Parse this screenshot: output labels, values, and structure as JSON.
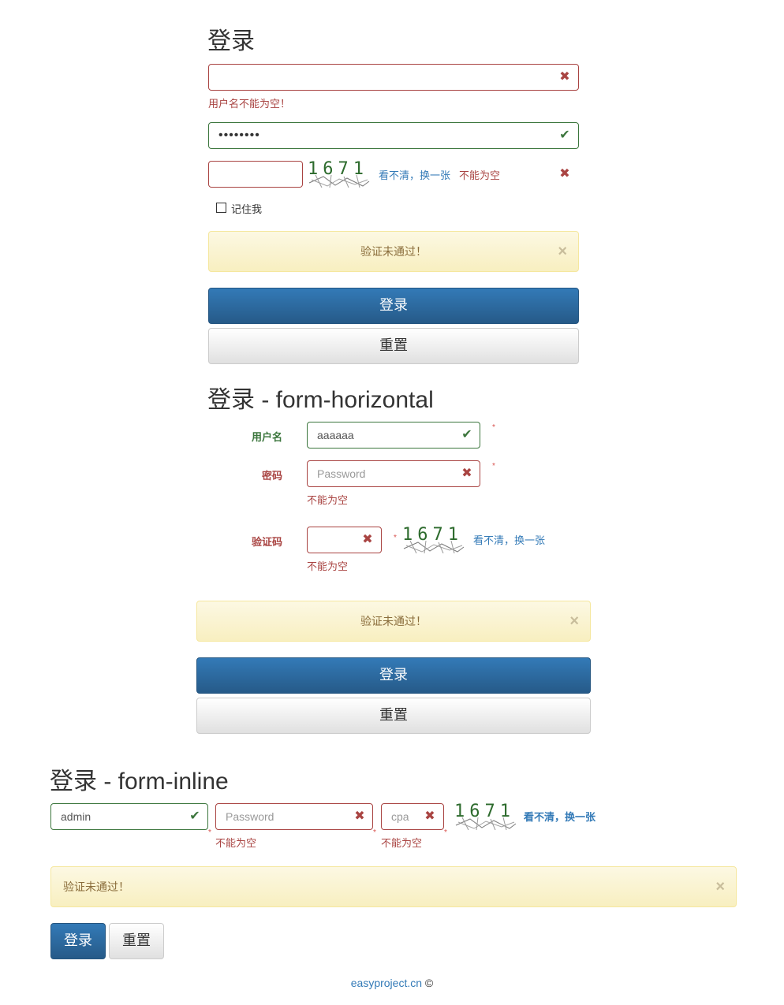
{
  "section1": {
    "title": "登录",
    "username_error": "用户名不能为空！",
    "password_value": "••••••••",
    "captcha_digits": "1671",
    "refresh_link": "看不清，换一张",
    "captcha_error": "不能为空",
    "remember_label": "记住我",
    "alert_text": "验证未通过！",
    "alert_close": "×",
    "login_button": "登录",
    "reset_button": "重置"
  },
  "section2": {
    "title": "登录 - form-horizontal",
    "username_label": "用户名",
    "username_value": "aaaaaa",
    "password_label": "密码",
    "password_placeholder": "Password",
    "password_error": "不能为空",
    "captcha_label": "验证码",
    "captcha_digits": "1671",
    "refresh_link": "看不清，换一张",
    "captcha_error": "不能为空",
    "required_mark": "*",
    "alert_text": "验证未通过！",
    "alert_close": "×",
    "login_button": "登录",
    "reset_button": "重置"
  },
  "section3": {
    "title": "登录 - form-inline",
    "username_value": "admin",
    "password_placeholder": "Password",
    "password_error": "不能为空",
    "captcha_placeholder": "cpa",
    "captcha_error": "不能为空",
    "captcha_digits": "1671",
    "refresh_link": "看不清，换一张",
    "required_mark": "*",
    "alert_text": "验证未通过！",
    "alert_close": "×",
    "login_button": "登录",
    "reset_button": "重置"
  },
  "footer": {
    "link_text": "easyproject.cn",
    "copyright": "©"
  },
  "icons": {
    "error": "✖",
    "ok": "✔"
  },
  "colors": {
    "error": "#a94442",
    "success": "#3c763d",
    "primary": "#337ab7",
    "warning_bg": "#fcf8e3"
  }
}
